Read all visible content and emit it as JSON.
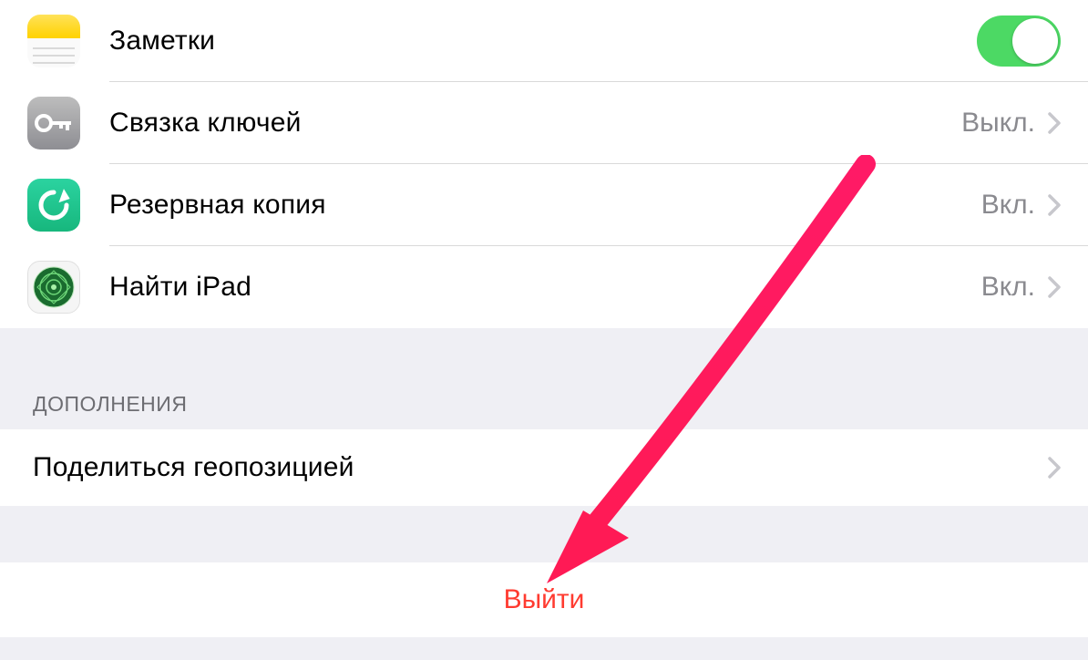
{
  "icloud_items": [
    {
      "id": "notes",
      "label": "Заметки",
      "toggle": true
    },
    {
      "id": "keychain",
      "label": "Связка ключей",
      "value": "Выкл."
    },
    {
      "id": "backup",
      "label": "Резервная копия",
      "value": "Вкл."
    },
    {
      "id": "find",
      "label": "Найти iPad",
      "value": "Вкл."
    }
  ],
  "section_extensions_header": "ДОПОЛНЕНИЯ",
  "extensions": [
    {
      "id": "share-location",
      "label": "Поделиться геопозицией"
    }
  ],
  "signout_label": "Выйти"
}
